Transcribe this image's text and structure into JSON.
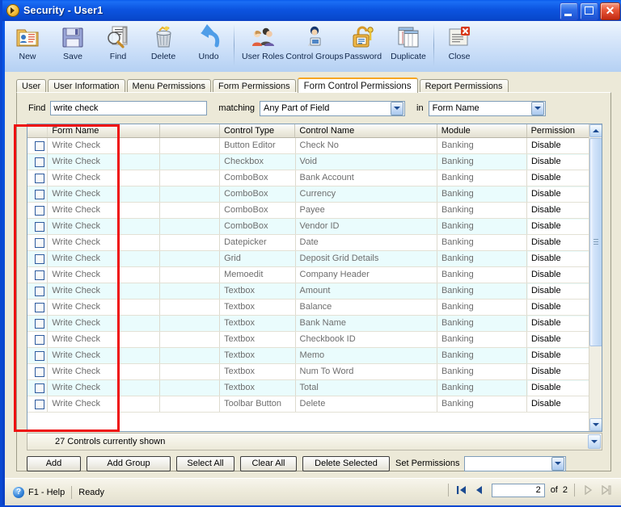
{
  "window": {
    "title": "Security - User1",
    "icon": "app-security-icon",
    "controls": {
      "minimize": "_",
      "maximize": "□",
      "close": "✕"
    }
  },
  "toolbar": {
    "items": [
      {
        "label": "New",
        "icon": "new-record-icon"
      },
      {
        "label": "Save",
        "icon": "floppy-disk-save-icon"
      },
      {
        "label": "Find",
        "icon": "magnifier-find-icon"
      },
      {
        "label": "Delete",
        "icon": "trash-delete-icon"
      },
      {
        "label": "Undo",
        "icon": "undo-arrow-icon"
      },
      {
        "label": "User Roles",
        "icon": "users-group-icon"
      },
      {
        "label": "Control Groups",
        "icon": "user-computer-icon"
      },
      {
        "label": "Password",
        "icon": "padlock-key-icon"
      },
      {
        "label": "Duplicate",
        "icon": "duplicate-pages-icon"
      },
      {
        "label": "Close",
        "icon": "close-window-icon"
      }
    ]
  },
  "tabs": [
    {
      "label": "User",
      "active": false
    },
    {
      "label": "User Information",
      "active": false
    },
    {
      "label": "Menu Permissions",
      "active": false
    },
    {
      "label": "Form Permissions",
      "active": false
    },
    {
      "label": "Form Control Permissions",
      "active": true
    },
    {
      "label": "Report Permissions",
      "active": false
    }
  ],
  "find": {
    "label": "Find",
    "value": "write check",
    "placeholder": "",
    "matching_label": "matching",
    "matching_value": "Any Part of Field",
    "in_label": "in",
    "in_value": "Form Name"
  },
  "grid": {
    "columns": [
      "",
      "Form Name",
      "",
      "Control Type",
      "Control Name",
      "Module",
      "Permission"
    ],
    "rows": [
      {
        "checked": false,
        "form": "Write Check",
        "type": "Button Editor",
        "name": "Check No",
        "module": "Banking",
        "permission": "Disable"
      },
      {
        "checked": false,
        "form": "Write Check",
        "type": "Checkbox",
        "name": "Void",
        "module": "Banking",
        "permission": "Disable"
      },
      {
        "checked": false,
        "form": "Write Check",
        "type": "ComboBox",
        "name": "Bank Account",
        "module": "Banking",
        "permission": "Disable"
      },
      {
        "checked": false,
        "form": "Write Check",
        "type": "ComboBox",
        "name": "Currency",
        "module": "Banking",
        "permission": "Disable"
      },
      {
        "checked": false,
        "form": "Write Check",
        "type": "ComboBox",
        "name": "Payee",
        "module": "Banking",
        "permission": "Disable"
      },
      {
        "checked": false,
        "form": "Write Check",
        "type": "ComboBox",
        "name": "Vendor ID",
        "module": "Banking",
        "permission": "Disable"
      },
      {
        "checked": false,
        "form": "Write Check",
        "type": "Datepicker",
        "name": "Date",
        "module": "Banking",
        "permission": "Disable"
      },
      {
        "checked": false,
        "form": "Write Check",
        "type": "Grid",
        "name": "Deposit Grid Details",
        "module": "Banking",
        "permission": "Disable"
      },
      {
        "checked": false,
        "form": "Write Check",
        "type": "Memoedit",
        "name": "Company Header",
        "module": "Banking",
        "permission": "Disable"
      },
      {
        "checked": false,
        "form": "Write Check",
        "type": "Textbox",
        "name": "Amount",
        "module": "Banking",
        "permission": "Disable"
      },
      {
        "checked": false,
        "form": "Write Check",
        "type": "Textbox",
        "name": "Balance",
        "module": "Banking",
        "permission": "Disable"
      },
      {
        "checked": false,
        "form": "Write Check",
        "type": "Textbox",
        "name": "Bank Name",
        "module": "Banking",
        "permission": "Disable"
      },
      {
        "checked": false,
        "form": "Write Check",
        "type": "Textbox",
        "name": "Checkbook ID",
        "module": "Banking",
        "permission": "Disable"
      },
      {
        "checked": false,
        "form": "Write Check",
        "type": "Textbox",
        "name": "Memo",
        "module": "Banking",
        "permission": "Disable"
      },
      {
        "checked": false,
        "form": "Write Check",
        "type": "Textbox",
        "name": "Num To Word",
        "module": "Banking",
        "permission": "Disable"
      },
      {
        "checked": false,
        "form": "Write Check",
        "type": "Textbox",
        "name": "Total",
        "module": "Banking",
        "permission": "Disable"
      },
      {
        "checked": false,
        "form": "Write Check",
        "type": "Toolbar Button",
        "name": "Delete",
        "module": "Banking",
        "permission": "Disable"
      }
    ]
  },
  "count_bar": {
    "text": "27 Controls currently shown"
  },
  "actions": {
    "add": "Add",
    "add_group": "Add Group",
    "select_all": "Select All",
    "clear_all": "Clear All",
    "delete_selected": "Delete Selected",
    "set_permissions_label": "Set Permissions",
    "set_permissions_value": ""
  },
  "status": {
    "help": "F1 - Help",
    "state": "Ready",
    "page_value": "2",
    "of_label": "of",
    "page_total": "2"
  },
  "annotation": {
    "color": "#ee1111"
  }
}
